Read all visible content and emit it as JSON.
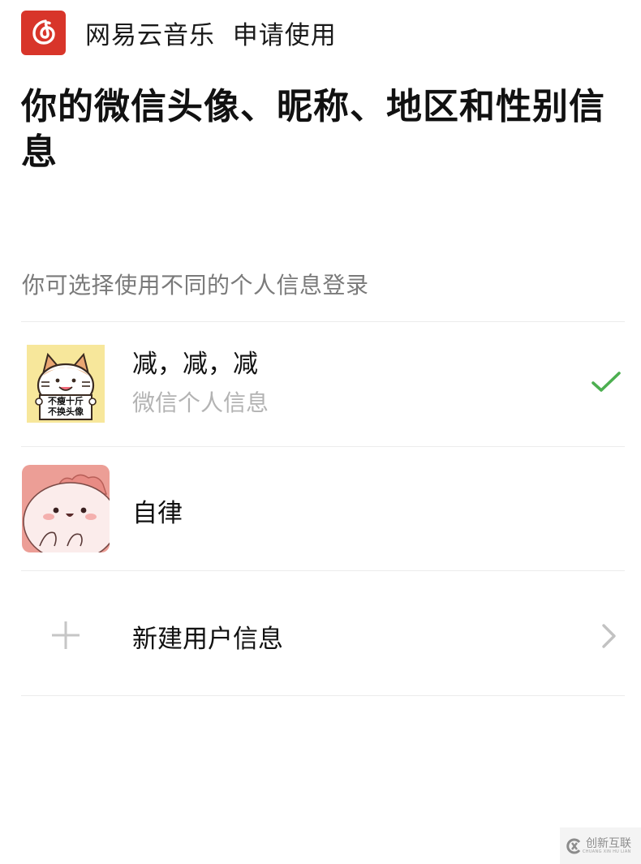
{
  "header": {
    "app_name_and_action": "网易云音乐  申请使用",
    "logo_icon": "netease-music-logo-icon"
  },
  "page_title": "你的微信头像、昵称、地区和性别信息",
  "subtitle": "你可选择使用不同的个人信息登录",
  "profiles": [
    {
      "name": "减，减，减",
      "description": "微信个人信息",
      "avatar_caption": [
        "不瘦十斤",
        "不换头像"
      ],
      "selected": true,
      "avatar_icon": "cat-sticker-avatar"
    },
    {
      "name": "自律",
      "description": "",
      "selected": false,
      "avatar_icon": "pink-dinosaur-avatar"
    }
  ],
  "new_profile": {
    "label": "新建用户信息",
    "icon": "plus-icon",
    "chevron": "chevron-right-icon"
  },
  "colors": {
    "brand_red": "#d8352a",
    "check_green": "#4caf50",
    "secondary_text": "#7a7a7a",
    "tertiary_text": "#b3b3b3"
  },
  "watermark": {
    "text": "创新互联",
    "subtext": "CHUANG XIN HU LIAN"
  }
}
